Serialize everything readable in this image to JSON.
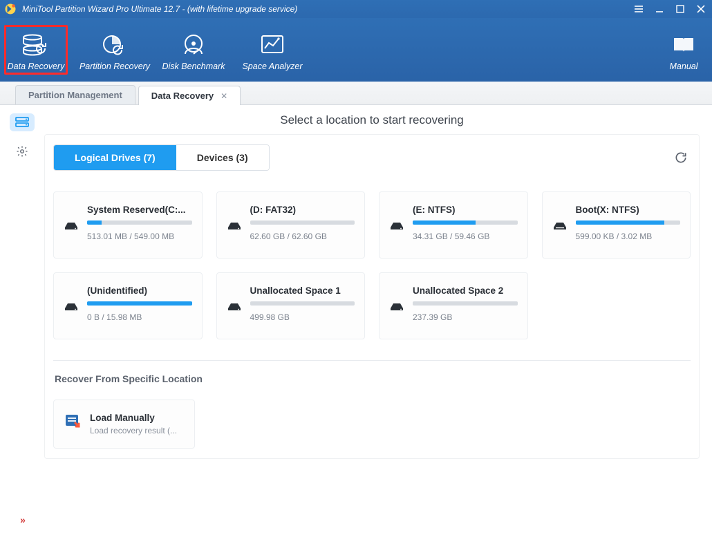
{
  "title": "MiniTool Partition Wizard Pro Ultimate 12.7 - (with lifetime upgrade service)",
  "ribbon": {
    "items": [
      {
        "label": "Data Recovery",
        "icon": "disks-recover",
        "highlight": true
      },
      {
        "label": "Partition Recovery",
        "icon": "pie-recover"
      },
      {
        "label": "Disk Benchmark",
        "icon": "disk-gauge"
      },
      {
        "label": "Space Analyzer",
        "icon": "chart-window"
      }
    ],
    "manual_label": "Manual"
  },
  "page_tabs": {
    "tab1": "Partition Management",
    "tab2": "Data Recovery"
  },
  "heading": "Select a location to start recovering",
  "drive_tabs": {
    "logical_label": "Logical Drives (7)",
    "devices_label": "Devices (3)"
  },
  "drives": [
    {
      "title": "System Reserved(C:...",
      "sub": "513.01 MB / 549.00 MB",
      "fill_pct": 14
    },
    {
      "title": "(D: FAT32)",
      "sub": "62.60 GB / 62.60 GB",
      "fill_pct": 0
    },
    {
      "title": "(E: NTFS)",
      "sub": "34.31 GB / 59.46 GB",
      "fill_pct": 60
    },
    {
      "title": "Boot(X: NTFS)",
      "sub": "599.00 KB / 3.02 MB",
      "fill_pct": 85
    },
    {
      "title": "(Unidentified)",
      "sub": "0 B / 15.98 MB",
      "fill_pct": 100
    },
    {
      "title": "Unallocated Space 1",
      "sub": "499.98 GB",
      "fill_pct": 0
    },
    {
      "title": "Unallocated Space 2",
      "sub": "237.39 GB",
      "fill_pct": 0
    }
  ],
  "recover_section": "Recover From Specific Location",
  "manual": {
    "title": "Load Manually",
    "sub": "Load recovery result (..."
  },
  "icons": {
    "menu": "menu",
    "min": "minimize",
    "max": "maximize",
    "close": "close"
  }
}
